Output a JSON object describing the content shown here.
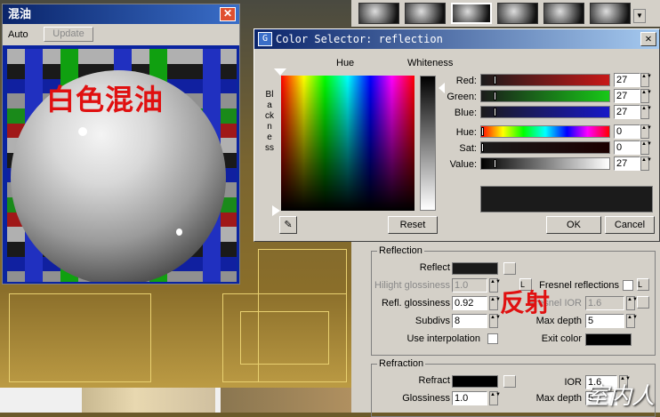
{
  "material_window": {
    "title": "混油",
    "close_glyph": "✕",
    "auto_label": "Auto",
    "update_label": "Update",
    "overlay_text": "白色混油"
  },
  "color_selector": {
    "title": "Color Selector: reflection",
    "icon_glyph": "G",
    "close_glyph": "✕",
    "hue_label": "Hue",
    "whiteness_label": "Whiteness",
    "blackness_label": "Blackness",
    "sliders": [
      {
        "label": "Red:",
        "value": "27"
      },
      {
        "label": "Green:",
        "value": "27"
      },
      {
        "label": "Blue:",
        "value": "27"
      },
      {
        "label": "Hue:",
        "value": "0"
      },
      {
        "label": "Sat:",
        "value": "0"
      },
      {
        "label": "Value:",
        "value": "27"
      }
    ],
    "reset_label": "Reset",
    "ok_label": "OK",
    "cancel_label": "Cancel",
    "current_color": "#1b1b1b"
  },
  "reflection": {
    "group_title": "Reflection",
    "reflect_label": "Reflect",
    "hilight_glossiness_label": "Hilight glossiness",
    "hilight_glossiness_value": "1.0",
    "lock_label": "L",
    "fresnel_label": "Fresnel reflections",
    "fresnel_lock": "L",
    "refl_glossiness_label": "Refl. glossiness",
    "refl_glossiness_value": "0.92",
    "fresnel_ior_label": "Fresnel IOR",
    "fresnel_ior_value": "1.6",
    "subdivs_label": "Subdivs",
    "subdivs_value": "8",
    "max_depth_label": "Max depth",
    "max_depth_value": "5",
    "use_interpolation_label": "Use interpolation",
    "exit_color_label": "Exit color",
    "overlay_text": "反射"
  },
  "refraction": {
    "group_title": "Refraction",
    "refract_label": "Refract",
    "ior_label": "IOR",
    "ior_value": "1.6",
    "glossiness_label": "Glossiness",
    "glossiness_value": "1.0",
    "max_depth_label": "Max depth",
    "max_depth_value": "5"
  },
  "watermark": "室内人",
  "colors": {
    "reflect_swatch": "#1a1a1a",
    "exit_color": "#000000",
    "refract_swatch": "#000000"
  }
}
